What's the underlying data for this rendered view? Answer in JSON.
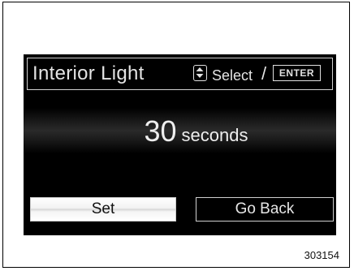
{
  "screen": {
    "title": "Interior Light",
    "hint_select": "Select",
    "hint_slash": "/",
    "hint_enter": "ENTER",
    "value_number": "30",
    "value_unit": "seconds",
    "buttons": {
      "set_label": "Set",
      "back_label": "Go Back"
    },
    "selected_button": "set"
  },
  "figure_code": "303154",
  "icons": {
    "select_icon": "up-down-arrows-icon"
  },
  "colors": {
    "screen_background": "#000000",
    "screen_text": "#e4e4e4",
    "selected_button": "#ffffff"
  }
}
